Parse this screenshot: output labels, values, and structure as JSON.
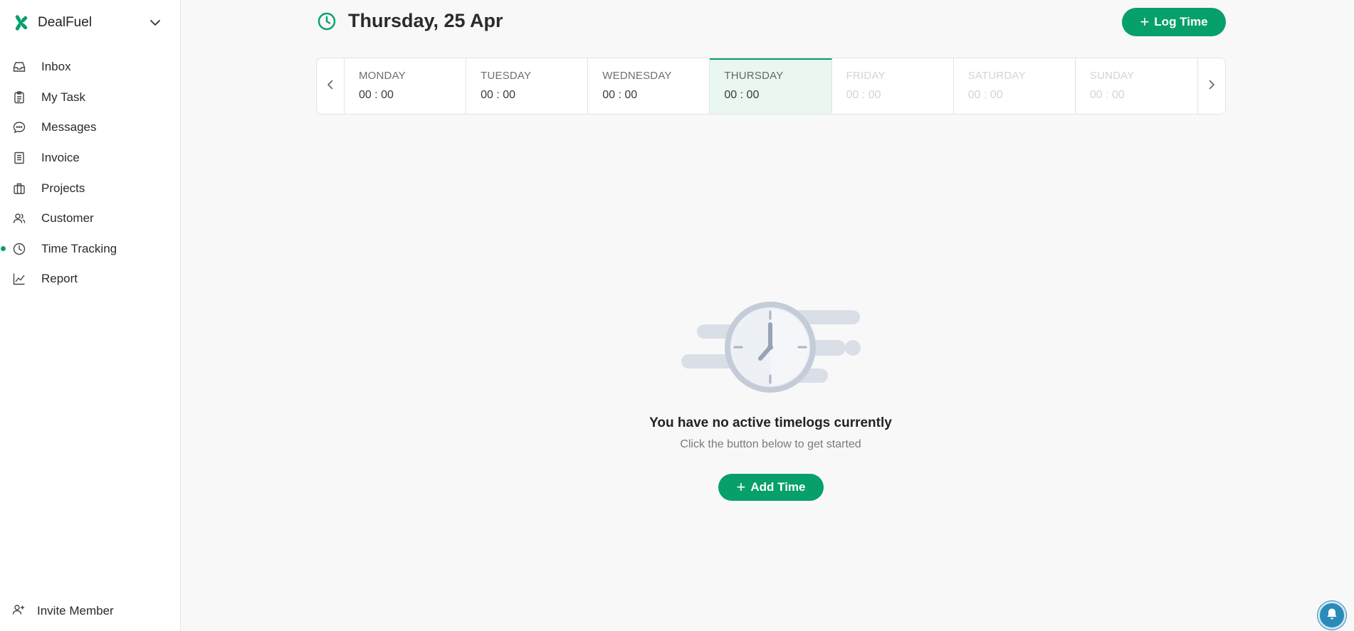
{
  "brand": {
    "name": "DealFuel",
    "logo_icon": "dealfuel-logo-icon",
    "accent_color": "#07a06a"
  },
  "nav": {
    "items": [
      {
        "label": "Inbox",
        "icon": "inbox-icon"
      },
      {
        "label": "My Task",
        "icon": "clipboard-icon"
      },
      {
        "label": "Messages",
        "icon": "chat-icon"
      },
      {
        "label": "Invoice",
        "icon": "invoice-icon"
      },
      {
        "label": "Projects",
        "icon": "briefcase-icon"
      },
      {
        "label": "Customer",
        "icon": "users-icon"
      },
      {
        "label": "Time Tracking",
        "icon": "clock-icon",
        "active": true
      },
      {
        "label": "Report",
        "icon": "chart-line-icon"
      }
    ],
    "invite_label": "Invite Member"
  },
  "header": {
    "title": "Thursday, 25 Apr",
    "log_time_label": "Log Time"
  },
  "week": {
    "days": [
      {
        "name": "MONDAY",
        "time": "00 : 00"
      },
      {
        "name": "TUESDAY",
        "time": "00 : 00"
      },
      {
        "name": "WEDNESDAY",
        "time": "00 : 00"
      },
      {
        "name": "THURSDAY",
        "time": "00 : 00",
        "active": true
      },
      {
        "name": "FRIDAY",
        "time": "00 : 00",
        "future": true
      },
      {
        "name": "SATURDAY",
        "time": "00 : 00",
        "future": true
      },
      {
        "name": "SUNDAY",
        "time": "00 : 00",
        "future": true
      }
    ]
  },
  "empty_state": {
    "title": "You have no active timelogs currently",
    "subtitle": "Click the button below to get started",
    "button_label": "Add Time"
  }
}
